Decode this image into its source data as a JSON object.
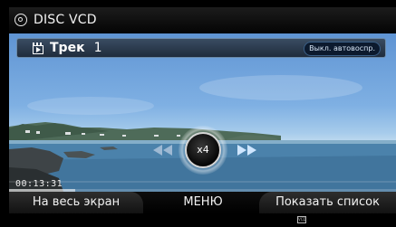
{
  "window": {
    "title": "DISC VCD"
  },
  "track": {
    "label": "Трек",
    "number": "1",
    "autoplay_badge": "Выкл. автовоспр."
  },
  "playback": {
    "speed": "x4",
    "elapsed": "00:13:31",
    "progress_fraction": 0.17
  },
  "menu": {
    "fullscreen": "На весь экран",
    "menu": "МЕНЮ",
    "show_list": "Показать список"
  },
  "footer": {
    "logo_icon": "vcd-logo-icon"
  }
}
